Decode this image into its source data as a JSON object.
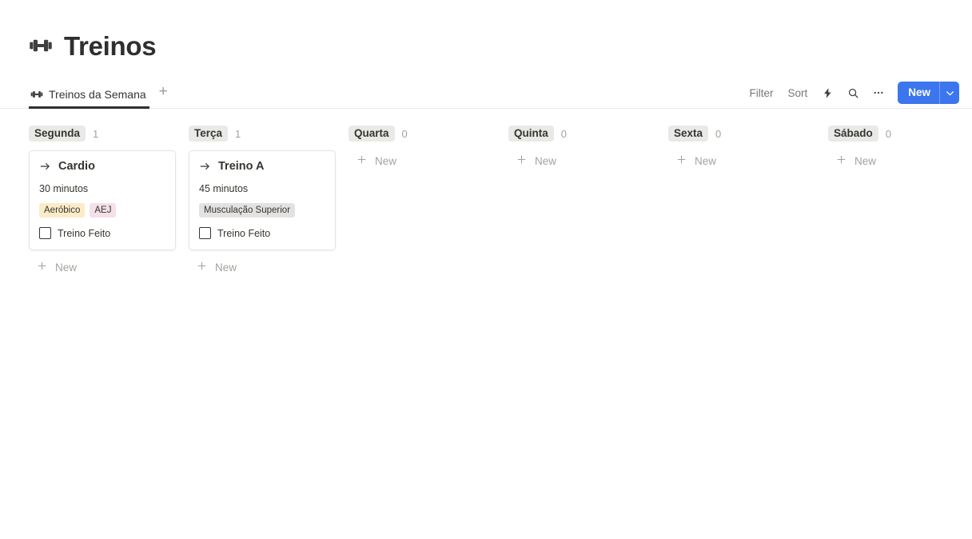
{
  "header": {
    "icon": "dumbbell-icon",
    "title": "Treinos"
  },
  "tabs": [
    {
      "label": "Treinos da Semana",
      "icon": "dumbbell-icon",
      "active": true
    }
  ],
  "tab_add_label": "+",
  "toolbar": {
    "filter_label": "Filter",
    "sort_label": "Sort",
    "automation_icon": "lightning-bolt-icon",
    "search_icon": "search-icon",
    "more_icon": "ellipsis-icon",
    "new_label": "New",
    "new_caret_icon": "chevron-down-icon",
    "new_button_color": "#3b76ef"
  },
  "board": {
    "new_row_label": "New",
    "columns": [
      {
        "day": "Segunda",
        "count": "1",
        "cards": [
          {
            "icon": "arrow-right-icon",
            "title": "Cardio",
            "duration": "30 minutos",
            "tags": [
              {
                "label": "Aeróbico",
                "color": "#fbecc8"
              },
              {
                "label": "AEJ",
                "color": "#f5dfe9"
              }
            ],
            "checkbox_label": "Treino Feito",
            "checked": false
          }
        ]
      },
      {
        "day": "Terça",
        "count": "1",
        "cards": [
          {
            "icon": "arrow-right-icon",
            "title": "Treino A",
            "duration": "45 minutos",
            "tags": [
              {
                "label": "Musculação Superior",
                "color": "#e3e2e0"
              }
            ],
            "checkbox_label": "Treino Feito",
            "checked": false
          }
        ]
      },
      {
        "day": "Quarta",
        "count": "0",
        "cards": []
      },
      {
        "day": "Quinta",
        "count": "0",
        "cards": []
      },
      {
        "day": "Sexta",
        "count": "0",
        "cards": []
      },
      {
        "day": "Sábado",
        "count": "0",
        "cards": []
      }
    ]
  }
}
